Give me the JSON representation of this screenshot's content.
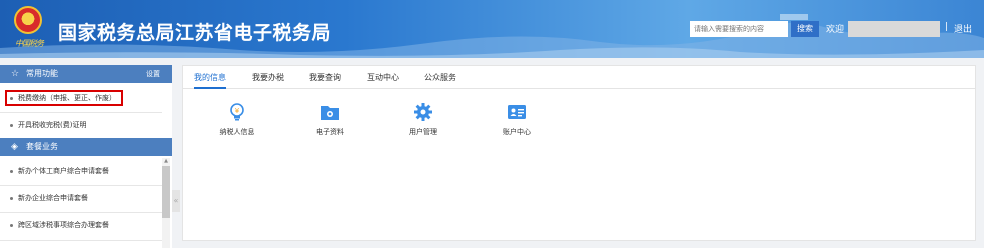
{
  "header": {
    "title": "国家税务总局江苏省电子税务局",
    "emblem_script": "中国税务",
    "search_placeholder": "请输入需要搜索的内容",
    "search_button": "搜索",
    "welcome": "欢迎",
    "separator": "|",
    "logout": "退出"
  },
  "sidebar": {
    "common_header": "常用功能",
    "settings": "设置",
    "common_items": [
      "税费缴纳（申报、更正、作废）",
      "开具税收完税(费)证明"
    ],
    "package_header": "套餐业务",
    "package_items": [
      "新办个体工商户综合申请套餐",
      "新办企业综合申请套餐",
      "跨区域涉税事项综合办理套餐"
    ],
    "collapse_glyph": "«"
  },
  "main": {
    "tabs": [
      {
        "label": "我的信息",
        "active": true
      },
      {
        "label": "我要办税",
        "active": false
      },
      {
        "label": "我要查询",
        "active": false
      },
      {
        "label": "互动中心",
        "active": false
      },
      {
        "label": "公众服务",
        "active": false
      }
    ],
    "functions": [
      {
        "label": "纳税人信息",
        "icon": "lightbulb-icon"
      },
      {
        "label": "电子资料",
        "icon": "folder-icon"
      },
      {
        "label": "用户管理",
        "icon": "gear-icon"
      },
      {
        "label": "账户中心",
        "icon": "id-card-icon"
      }
    ]
  },
  "colors": {
    "header_blue": "#2a78cf",
    "sidebar_header": "#4c7fbf",
    "active_tab": "#1e6fd0",
    "highlight_red": "#d80000",
    "icon_blue": "#3a8ee6"
  }
}
